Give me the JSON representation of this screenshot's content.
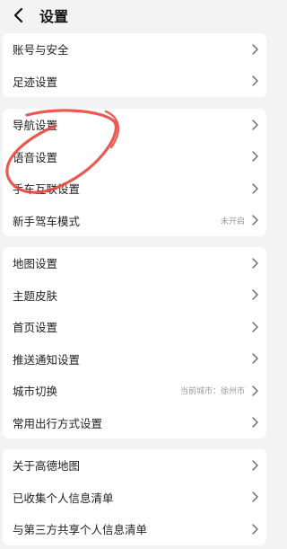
{
  "header": {
    "title": "设置",
    "back_icon": "chevron-left-icon"
  },
  "groups": [
    {
      "items": [
        {
          "label": "账号与安全",
          "value": ""
        },
        {
          "label": "足迹设置",
          "value": ""
        }
      ]
    },
    {
      "items": [
        {
          "label": "导航设置",
          "value": ""
        },
        {
          "label": "语音设置",
          "value": ""
        },
        {
          "label": "手车互联设置",
          "value": ""
        },
        {
          "label": "新手驾车模式",
          "value": "未开启"
        }
      ]
    },
    {
      "items": [
        {
          "label": "地图设置",
          "value": ""
        },
        {
          "label": "主题皮肤",
          "value": ""
        },
        {
          "label": "首页设置",
          "value": ""
        },
        {
          "label": "推送通知设置",
          "value": ""
        },
        {
          "label": "城市切换",
          "value": "当前城市：徐州市"
        },
        {
          "label": "常用出行方式设置",
          "value": ""
        }
      ]
    },
    {
      "items": [
        {
          "label": "关于高德地图",
          "value": ""
        },
        {
          "label": "已收集个人信息清单",
          "value": ""
        },
        {
          "label": "与第三方共享个人信息清单",
          "value": ""
        }
      ]
    }
  ],
  "annotation_color": "#e8473f",
  "chevron_icon": "chevron-right-icon"
}
